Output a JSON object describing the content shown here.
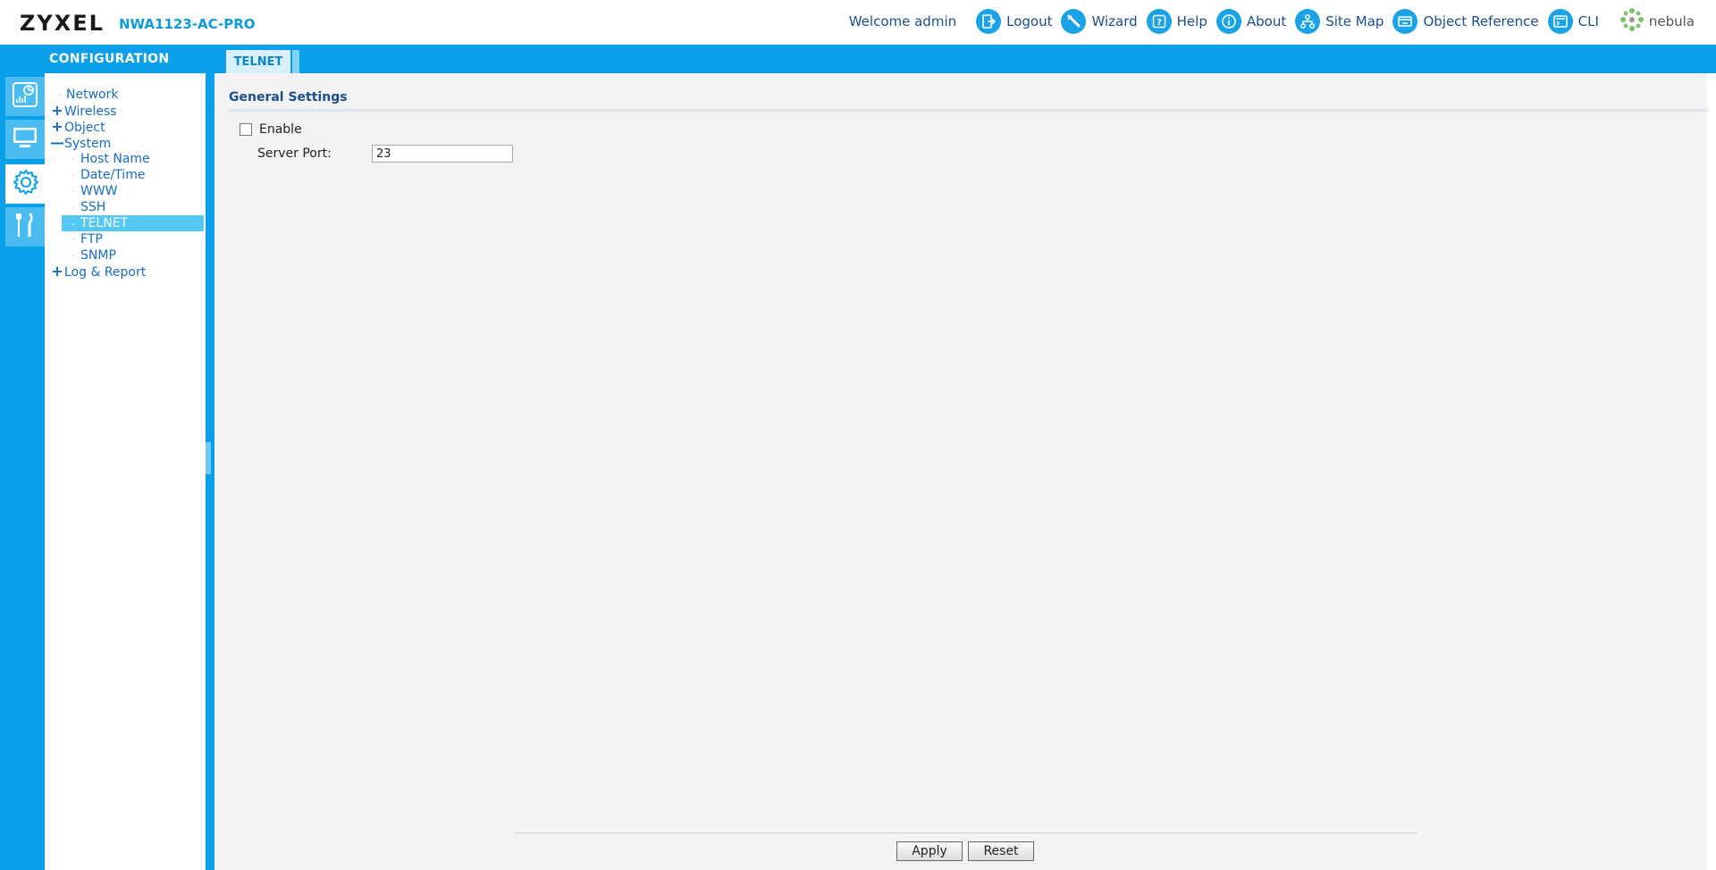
{
  "header": {
    "brand": "ZYXEL",
    "model": "NWA1123-AC-PRO",
    "welcome": "Welcome admin",
    "nav": [
      {
        "label": "Logout",
        "icon": "logout-icon"
      },
      {
        "label": "Wizard",
        "icon": "wizard-icon"
      },
      {
        "label": "Help",
        "icon": "help-icon"
      },
      {
        "label": "About",
        "icon": "about-icon"
      },
      {
        "label": "Site Map",
        "icon": "site-map-icon"
      },
      {
        "label": "Object Reference",
        "icon": "object-reference-icon"
      },
      {
        "label": "CLI",
        "icon": "cli-icon"
      }
    ],
    "nebula_label": "nebula"
  },
  "sidebar": {
    "title": "CONFIGURATION",
    "rail_icons": [
      "dashboard-icon",
      "monitor-icon",
      "configuration-gear-icon",
      "maintenance-tools-icon"
    ],
    "items": [
      {
        "label": "Network",
        "type": "leaf",
        "level": 0
      },
      {
        "label": "Wireless",
        "type": "expand",
        "level": 0,
        "mark": "+"
      },
      {
        "label": "Object",
        "type": "expand",
        "level": 0,
        "mark": "+"
      },
      {
        "label": "System",
        "type": "collapse",
        "level": 0,
        "mark": "—"
      },
      {
        "label": "Host Name",
        "type": "leaf",
        "level": 1
      },
      {
        "label": "Date/Time",
        "type": "leaf",
        "level": 1
      },
      {
        "label": "WWW",
        "type": "leaf",
        "level": 1
      },
      {
        "label": "SSH",
        "type": "leaf",
        "level": 1
      },
      {
        "label": "TELNET",
        "type": "leaf",
        "level": 1,
        "selected": true
      },
      {
        "label": "FTP",
        "type": "leaf",
        "level": 1
      },
      {
        "label": "SNMP",
        "type": "leaf",
        "level": 1
      },
      {
        "label": "Log & Report",
        "type": "expand",
        "level": 0,
        "mark": "+"
      }
    ]
  },
  "tabs": [
    {
      "label": "TELNET",
      "active": true
    }
  ],
  "main": {
    "section_title": "General Settings",
    "enable_label": "Enable",
    "enable_checked": false,
    "server_port_label": "Server Port:",
    "server_port_value": "23",
    "apply_label": "Apply",
    "reset_label": "Reset"
  },
  "colors": {
    "accent": "#0aa0e9",
    "link": "#1b6cc0",
    "selected": "#55c8f5",
    "model": "#0f9ad6"
  }
}
